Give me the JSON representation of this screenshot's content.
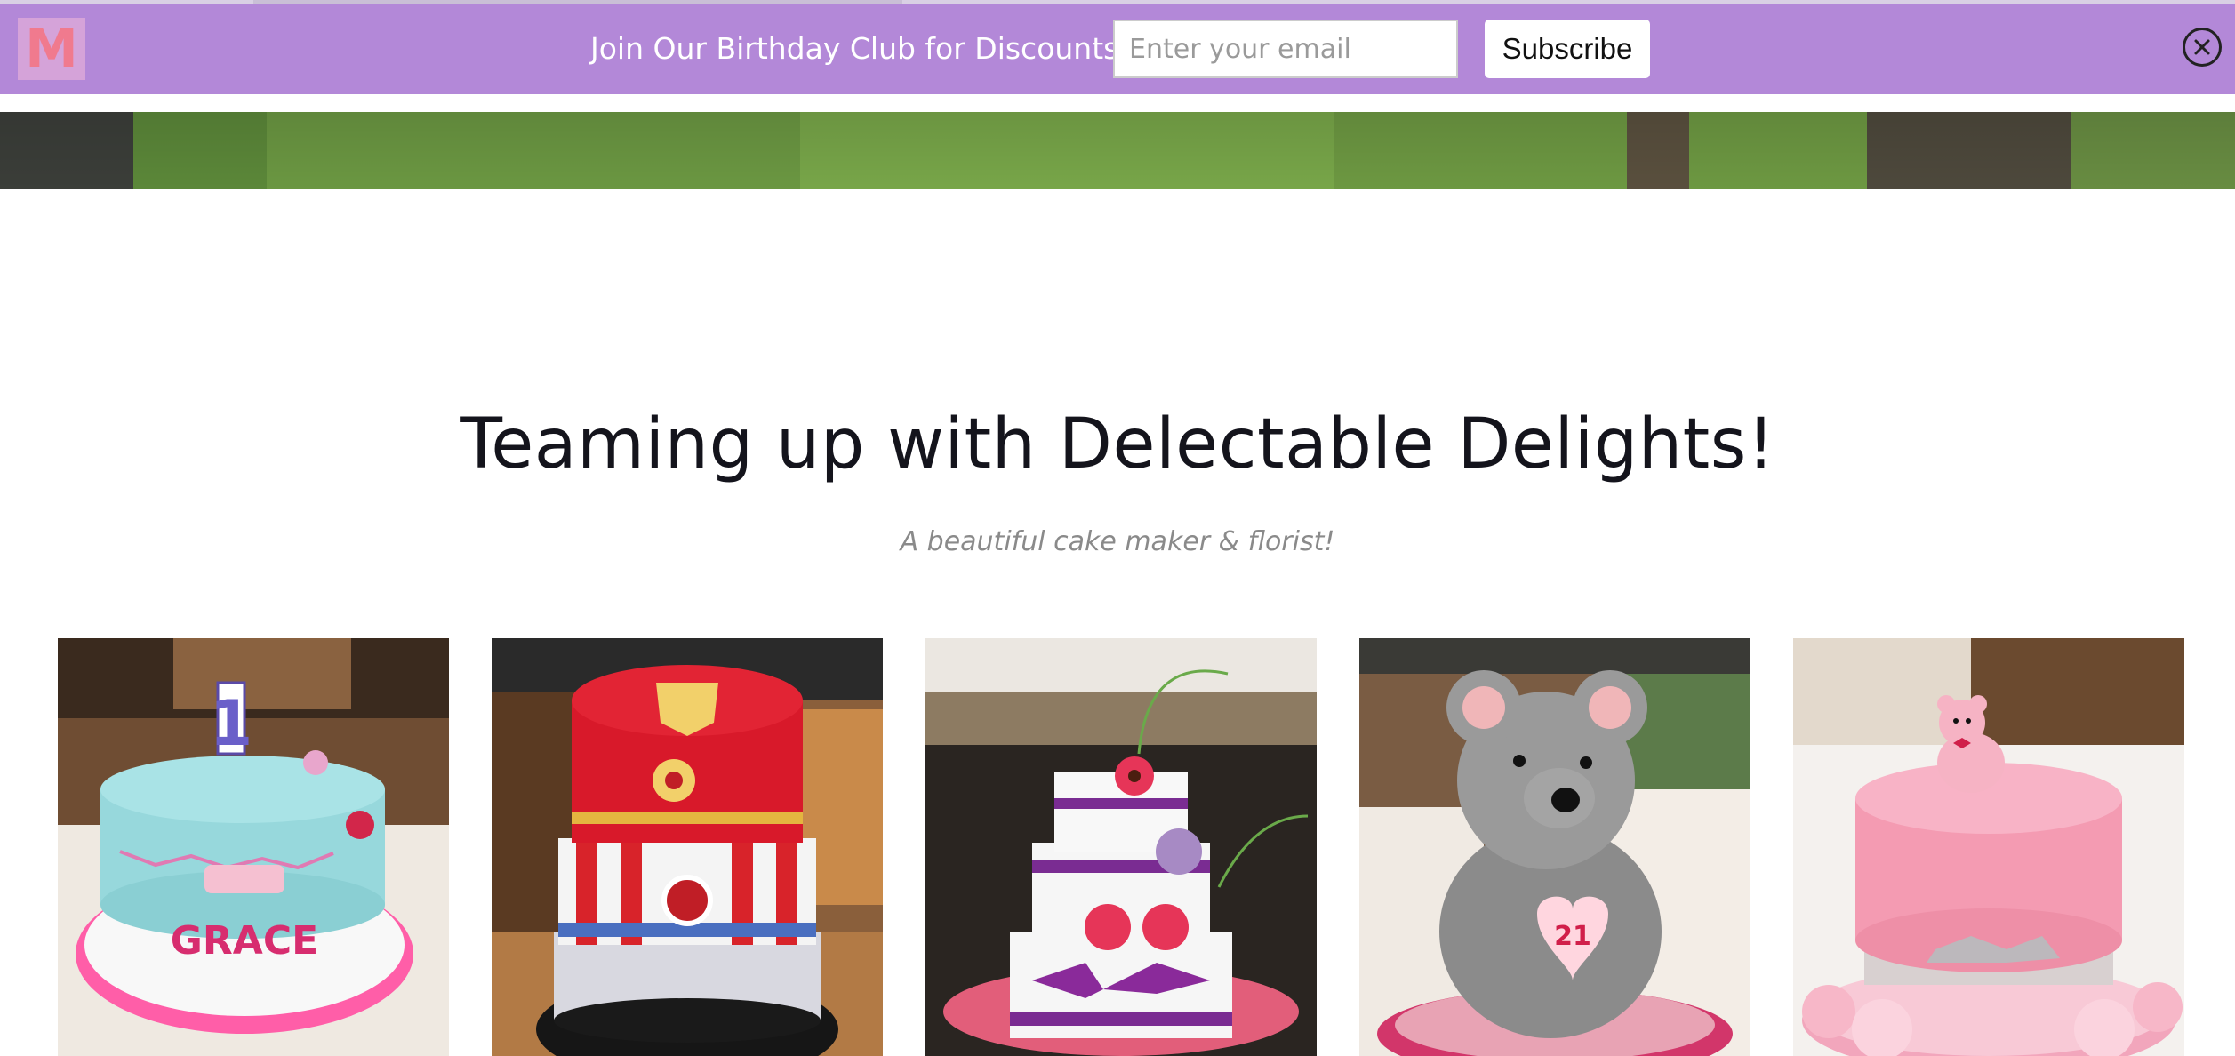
{
  "banner": {
    "logo_letter": "M",
    "message": "Join Our Birthday Club for Discounts!",
    "email_placeholder": "Enter your email",
    "subscribe_label": "Subscribe",
    "close_icon": "close-circle-icon",
    "background_color": "#b388d8"
  },
  "section": {
    "title": "Teaming up with Delectable Delights!",
    "subtitle": "A beautiful cake maker & florist!"
  },
  "gallery": {
    "items": [
      {
        "cake_text": "GRACE",
        "topper": "1"
      },
      {
        "cake_text": ""
      },
      {
        "cake_text": ""
      },
      {
        "cake_text": "21"
      },
      {
        "cake_text": ""
      }
    ]
  }
}
